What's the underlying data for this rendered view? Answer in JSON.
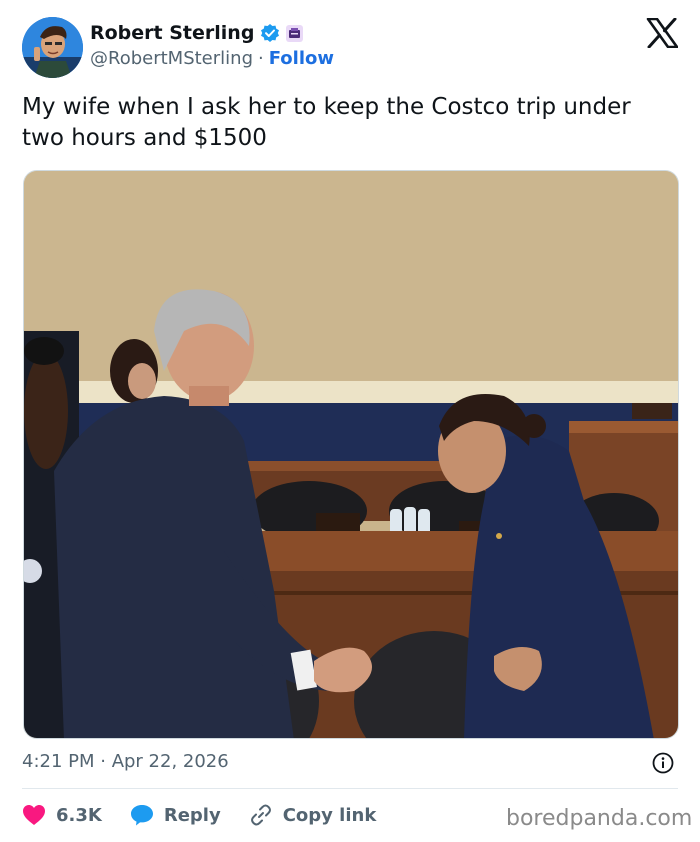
{
  "author": {
    "display_name": "Robert Sterling",
    "handle": "@RobertMSterling",
    "separator": "·",
    "follow_label": "Follow",
    "verified_color": "#1d9bf0"
  },
  "tweet": {
    "text": "My wife when I ask her to keep the Costco trip under two hours and $1500"
  },
  "meta": {
    "timestamp": "4:21 PM · Apr 22, 2026"
  },
  "actions": {
    "like_count": "6.3K",
    "reply_label": "Reply",
    "copy_label": "Copy link"
  },
  "watermark": "boredpanda.com",
  "colors": {
    "accent": "#1d6fe0",
    "like": "#f91880",
    "reply": "#1d9bf0",
    "muted": "#536471"
  },
  "icons": [
    "verified-badge-icon",
    "affiliate-badge-icon",
    "x-logo-icon",
    "info-icon",
    "heart-icon",
    "reply-bubble-icon",
    "link-icon"
  ]
}
